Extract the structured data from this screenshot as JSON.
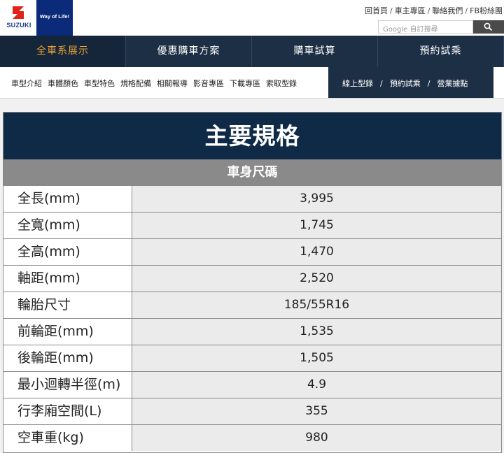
{
  "header": {
    "logo_text": "SUZUKI",
    "tagline": "Way of Life!",
    "top_links": [
      "回首頁",
      "車主專區",
      "聯絡我們",
      "FB粉絲團"
    ],
    "search_placeholder": "自訂搜尋",
    "search_brand": "Google"
  },
  "main_nav": [
    {
      "label": "全車系展示",
      "active": true
    },
    {
      "label": "優惠購車方案",
      "active": false
    },
    {
      "label": "購車試算",
      "active": false
    },
    {
      "label": "預約試乘",
      "active": false
    }
  ],
  "sub_nav": {
    "left": [
      "車型介紹",
      "車體顏色",
      "車型特色",
      "規格配備",
      "相關報導",
      "影音專區",
      "下載專區",
      "索取型錄"
    ],
    "right": [
      "線上型錄",
      "預約試乘",
      "營業據點"
    ]
  },
  "spec": {
    "title": "主要規格",
    "section": "車身尺碼",
    "rows": [
      {
        "label": "全長(mm)",
        "value": "3,995"
      },
      {
        "label": "全寬(mm)",
        "value": "1,745"
      },
      {
        "label": "全高(mm)",
        "value": "1,470"
      },
      {
        "label": "軸距(mm)",
        "value": "2,520"
      },
      {
        "label": "輪胎尺寸",
        "value": "185/55R16"
      },
      {
        "label": "前輪距(mm)",
        "value": "1,535"
      },
      {
        "label": "後輪距(mm)",
        "value": "1,505"
      },
      {
        "label": "最小迴轉半徑(m)",
        "value": "4.9"
      },
      {
        "label": "行李廂空間(L)",
        "value": "355"
      },
      {
        "label": "空車重(kg)",
        "value": "980"
      }
    ]
  },
  "colors": {
    "nav_bg": "#1d2f45",
    "nav_active_text": "#e8a23a",
    "title_bg": "#0f2a47",
    "section_bg": "#8a8a8a",
    "logo_blue": "#0b2a7a"
  },
  "icons": {
    "logo": "suzuki-s-logo-icon",
    "search": "search-icon"
  }
}
